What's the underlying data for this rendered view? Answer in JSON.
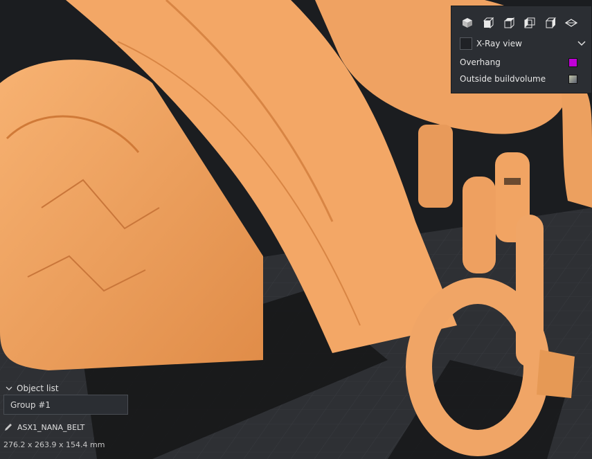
{
  "view_panel": {
    "view_buttons": [
      "3d-view",
      "front-view",
      "top-view",
      "left-view",
      "right-view",
      "layer-view"
    ],
    "xray_label": "X-Ray view",
    "legend": [
      {
        "label": "Overhang",
        "color": "#c000d8"
      },
      {
        "label": "Outside buildvolume",
        "color": "#8a8e7a"
      }
    ]
  },
  "object_list": {
    "header": "Object list",
    "selected_group": "Group #1",
    "object_name": "ASX1_NANA_BELT",
    "dimensions": "276.2 x 263.9 x 154.4 mm"
  },
  "colors": {
    "model": "#f2a05c",
    "plate": "#2e3034",
    "panel": "#2b2e33"
  }
}
